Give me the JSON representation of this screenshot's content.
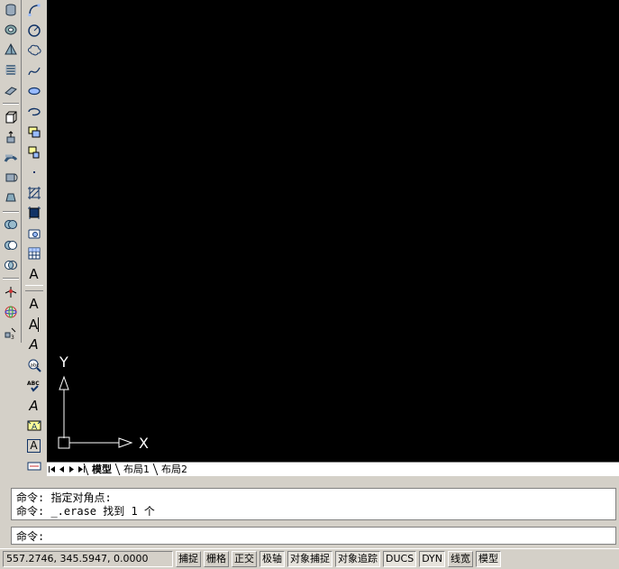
{
  "toolbars": {
    "modeling": [
      {
        "icon": "cylinder-icon"
      },
      {
        "icon": "torus-icon"
      },
      {
        "icon": "pyramid-icon"
      },
      {
        "icon": "helix-icon"
      },
      {
        "icon": "planar-surface-icon"
      },
      {
        "sep": true
      },
      {
        "icon": "extrude-icon"
      },
      {
        "icon": "presspull-icon"
      },
      {
        "icon": "sweep-icon"
      },
      {
        "icon": "revolve-icon"
      },
      {
        "icon": "loft-icon"
      },
      {
        "sep": true
      },
      {
        "icon": "union-icon"
      },
      {
        "icon": "subtract-icon"
      },
      {
        "icon": "intersect-icon"
      },
      {
        "sep": true
      },
      {
        "icon": "3d-move-icon"
      },
      {
        "icon": "3d-rotate-icon"
      },
      {
        "icon": "3d-align-icon"
      }
    ],
    "draw": [
      {
        "icon": "arc-icon"
      },
      {
        "icon": "circle-icon"
      },
      {
        "icon": "revcloud-icon"
      },
      {
        "icon": "spline-icon"
      },
      {
        "icon": "ellipse-icon"
      },
      {
        "icon": "ellipse-arc-icon"
      },
      {
        "icon": "insert-block-icon"
      },
      {
        "icon": "make-block-icon"
      },
      {
        "icon": "point-icon"
      },
      {
        "icon": "hatch-icon"
      },
      {
        "icon": "gradient-icon"
      },
      {
        "icon": "region-icon"
      },
      {
        "icon": "table-icon"
      },
      {
        "icon": "mtext-icon",
        "text": "A"
      },
      {
        "grip": true
      },
      {
        "icon": "text-icon",
        "text": "A"
      },
      {
        "icon": "edit-text-icon",
        "text": "A"
      },
      {
        "icon": "text-style-icon",
        "text": "A"
      },
      {
        "icon": "find-text-icon"
      },
      {
        "icon": "spell-check-icon"
      },
      {
        "icon": "text-scale-icon",
        "text": "A"
      },
      {
        "icon": "text-justify-icon"
      },
      {
        "icon": "text-frame-icon",
        "text": "A"
      },
      {
        "icon": "text-convert-icon"
      }
    ]
  },
  "canvas": {
    "background": "#000000",
    "ucs": {
      "x_label": "X",
      "y_label": "Y"
    }
  },
  "layout_tabs": {
    "nav": [
      "first-tab",
      "prev-tab",
      "next-tab",
      "last-tab"
    ],
    "tabs": [
      "模型",
      "布局1",
      "布局2"
    ],
    "active": 0
  },
  "command": {
    "history": [
      "命令: 指定对角点:",
      "命令: _.erase 找到 1 个"
    ],
    "prompt": "命令:",
    "input_value": ""
  },
  "status_bar": {
    "coordinates": "557.2746,  345.5947, 0.0000",
    "toggles": [
      {
        "label": "捕捉",
        "on": false
      },
      {
        "label": "栅格",
        "on": false
      },
      {
        "label": "正交",
        "on": false
      },
      {
        "label": "极轴",
        "on": true
      },
      {
        "label": "对象捕捉",
        "on": true
      },
      {
        "label": "对象追踪",
        "on": true
      },
      {
        "label": "DUCS",
        "on": true
      },
      {
        "label": "DYN",
        "on": true
      },
      {
        "label": "线宽",
        "on": false
      },
      {
        "label": "模型",
        "on": true
      }
    ]
  }
}
